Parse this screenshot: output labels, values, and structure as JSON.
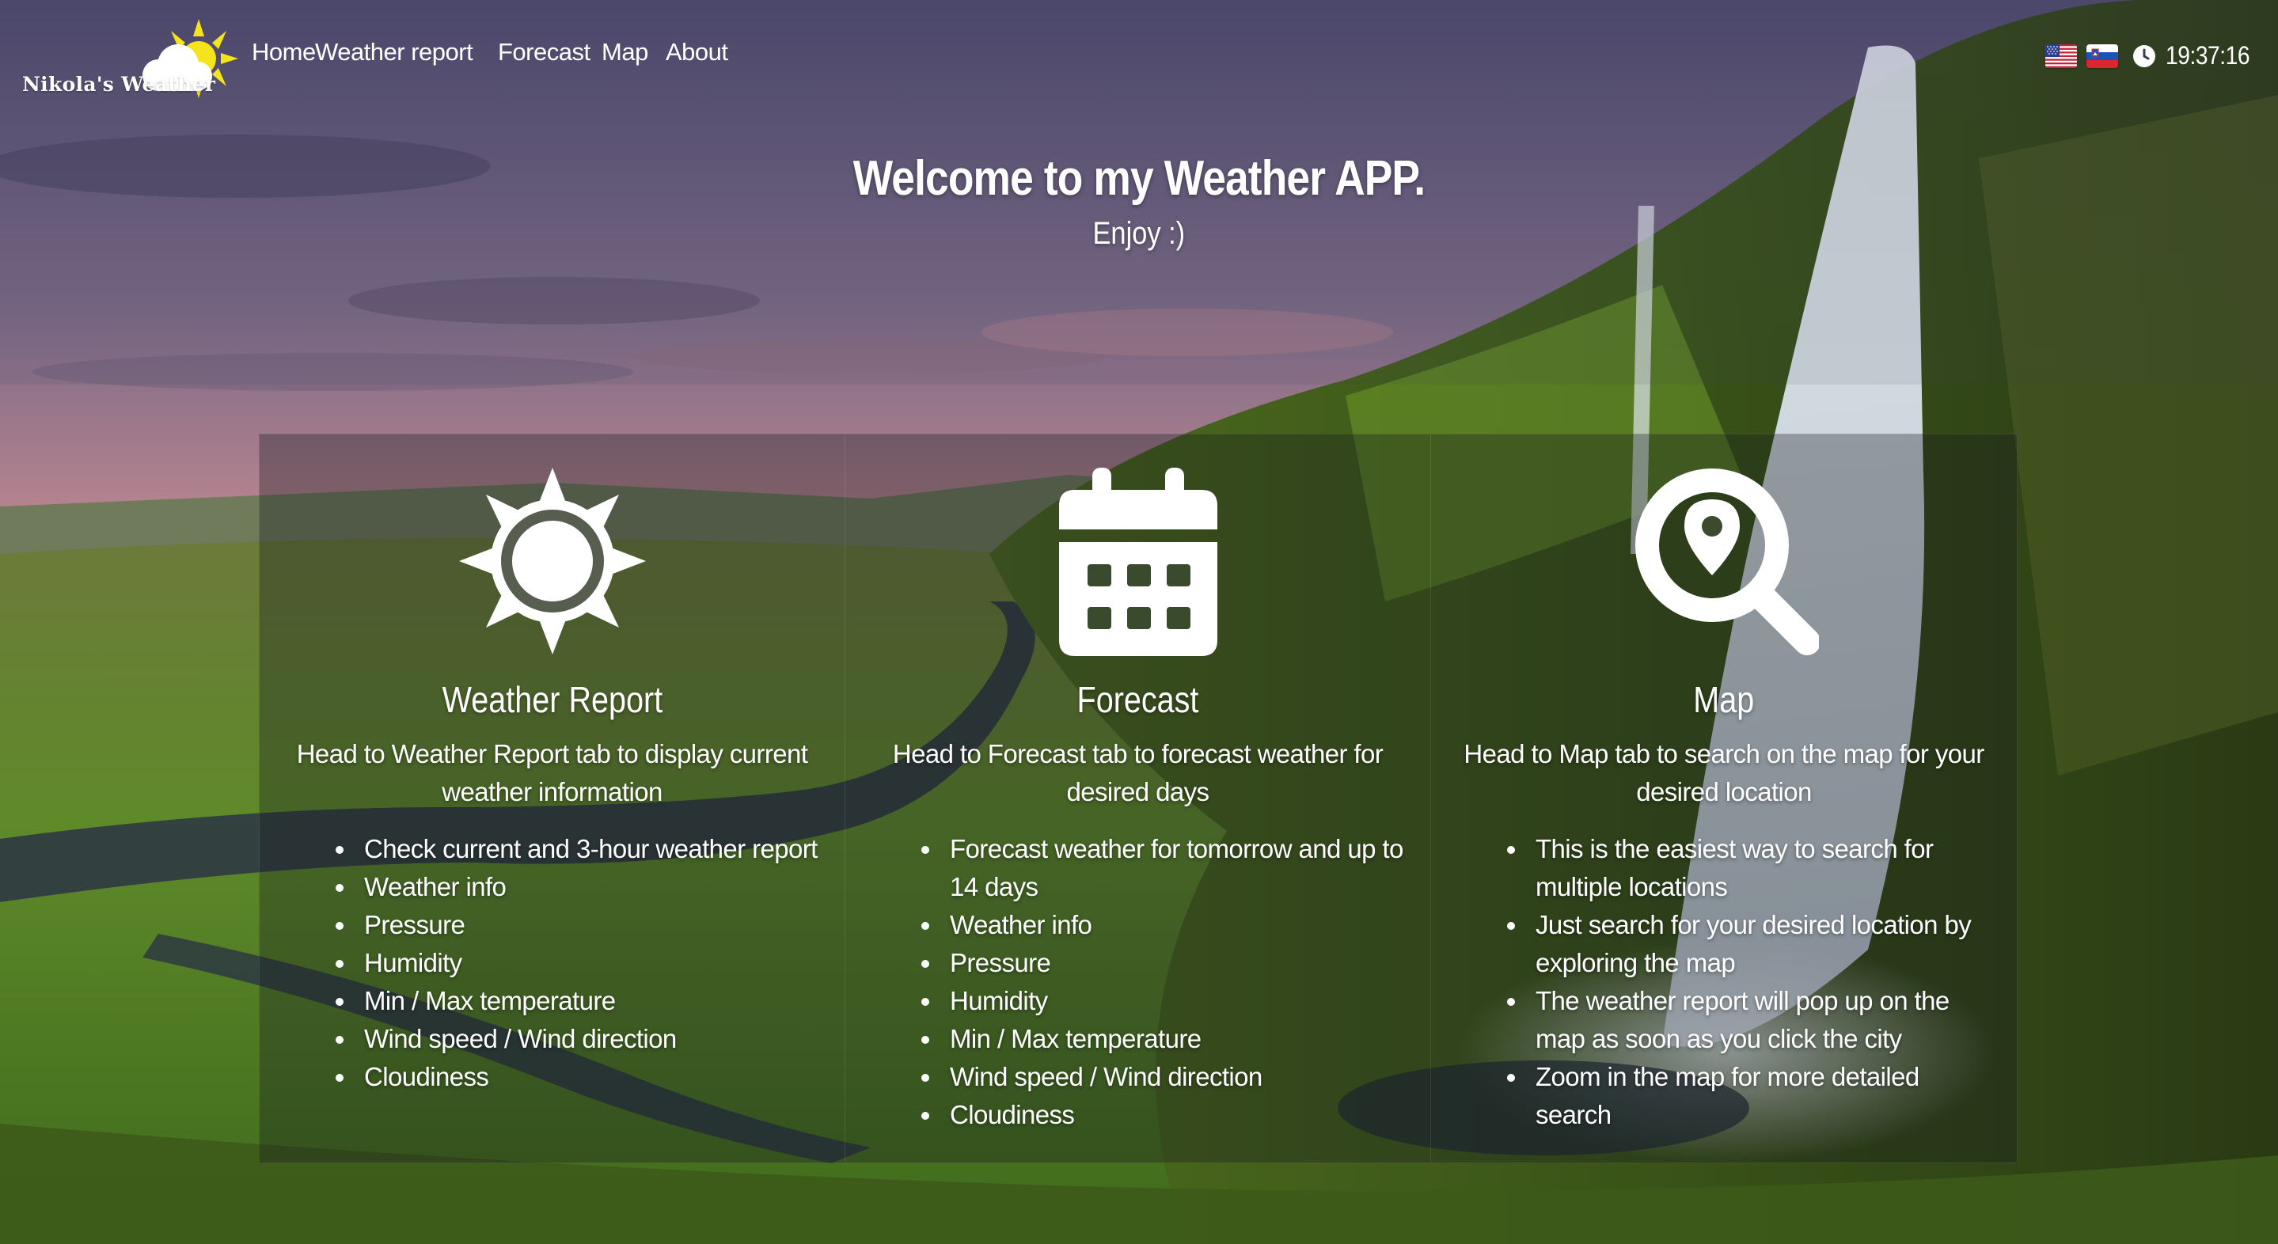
{
  "brand": {
    "name": "Nikola's Weather",
    "icon": "sun-cloud-logo"
  },
  "nav": {
    "links": [
      {
        "label": "Home"
      },
      {
        "label": "Weather report"
      },
      {
        "label": "Forecast"
      },
      {
        "label": "Map"
      },
      {
        "label": "About"
      }
    ],
    "languages": [
      {
        "icon": "us-flag-icon"
      },
      {
        "icon": "slovenia-flag-icon"
      }
    ],
    "clock": {
      "icon": "clock-icon",
      "time": "19:37:16"
    }
  },
  "hero": {
    "title": "Welcome to my Weather APP.",
    "subtitle": "Enjoy :)"
  },
  "features": [
    {
      "icon": "sun-icon",
      "title": "Weather Report",
      "description": "Head to Weather Report tab to display current weather information",
      "items": [
        "Check current and 3-hour weather report",
        "Weather info",
        "Pressure",
        "Humidity",
        "Min / Max temperature",
        "Wind speed / Wind direction",
        "Cloudiness"
      ]
    },
    {
      "icon": "calendar-icon",
      "title": "Forecast",
      "description": "Head to Forecast tab to forecast weather for desired days",
      "items": [
        "Forecast weather for tomorrow and up to 14 days",
        "Weather info",
        "Pressure",
        "Humidity",
        "Min / Max temperature",
        "Wind speed / Wind direction",
        "Cloudiness"
      ]
    },
    {
      "icon": "search-location-icon",
      "title": "Map",
      "description": "Head to Map tab to search on the map for your desired location",
      "items": [
        "This is the easiest way to search for multiple locations",
        "Just search for your desired location by exploring the map",
        "The weather report will pop up on the map as soon as you click the city",
        "Zoom in the map for more detailed search"
      ]
    }
  ],
  "colors": {
    "text": "#ffffff",
    "panel": "#14181e",
    "sun": "#f4e41c"
  }
}
